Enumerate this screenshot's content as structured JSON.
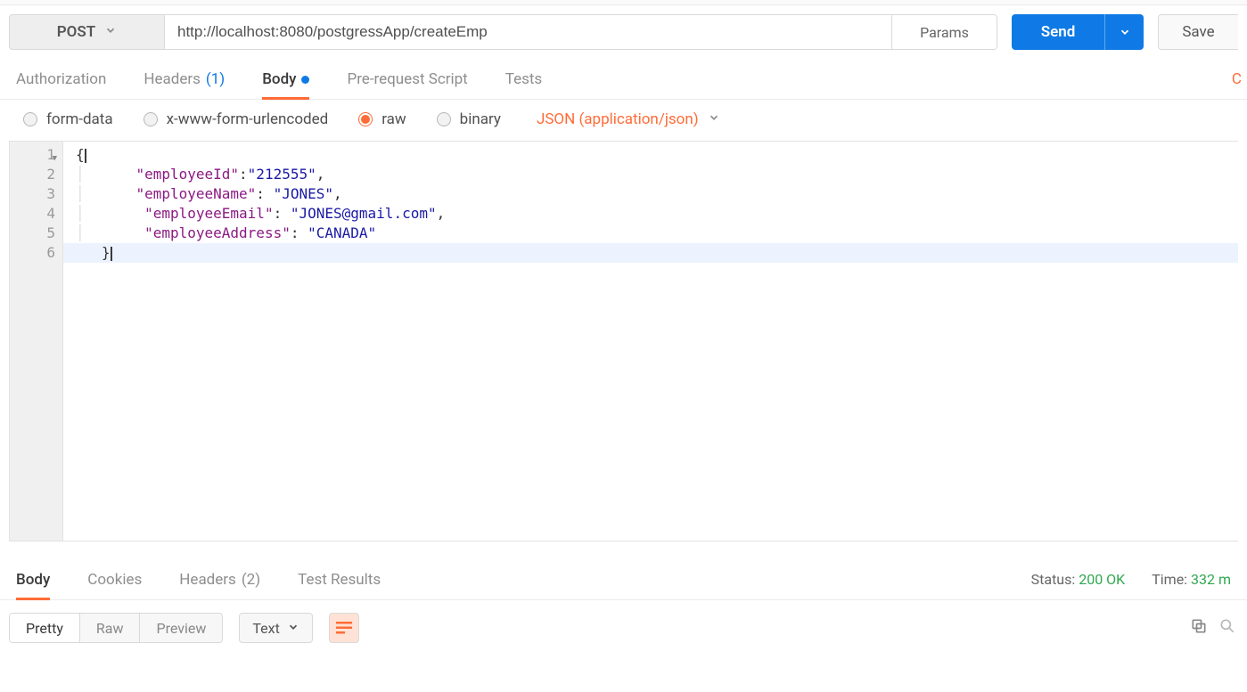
{
  "request": {
    "method": "POST",
    "url": "http://localhost:8080/postgressApp/createEmp",
    "params_label": "Params",
    "send_label": "Send",
    "save_label": "Save"
  },
  "request_tabs": {
    "authorization": "Authorization",
    "headers": "Headers",
    "headers_count": "(1)",
    "body": "Body",
    "prerequest": "Pre-request Script",
    "tests": "Tests",
    "overflow": "C"
  },
  "body_types": {
    "formdata": "form-data",
    "urlencoded": "x-www-form-urlencoded",
    "raw": "raw",
    "binary": "binary",
    "content_type": "JSON (application/json)",
    "selected": "raw"
  },
  "editor": {
    "line_numbers": [
      "1",
      "2",
      "3",
      "4",
      "5",
      "6"
    ],
    "json_payload": {
      "employeeId": "212555",
      "employeeName": "JONES",
      "employeeEmail": "JONES@gmail.com",
      "employeeAddress": "CANADA"
    },
    "lines": [
      {
        "indent": 0,
        "raw": "{"
      },
      {
        "indent": 1,
        "key": "employeeId",
        "sep": ":",
        "val": "212555",
        "trail": ","
      },
      {
        "indent": 1,
        "key": "employeeName",
        "sep": ": ",
        "val": "JONES",
        "trail": ","
      },
      {
        "indent": 1,
        "key": "employeeEmail",
        "sep": ": ",
        "val": "JONES@gmail.com",
        "trail": ","
      },
      {
        "indent": 1,
        "key": "employeeAddress",
        "sep": ": ",
        "val": "CANADA",
        "trail": ""
      },
      {
        "indent": 0,
        "raw": "}"
      }
    ],
    "highlight_line": 6
  },
  "response_tabs": {
    "body": "Body",
    "cookies": "Cookies",
    "headers": "Headers",
    "headers_count": "(2)",
    "test_results": "Test Results"
  },
  "response_status": {
    "status_label": "Status:",
    "status_value": "200 OK",
    "time_label": "Time:",
    "time_value": "332 m"
  },
  "response_view": {
    "pretty": "Pretty",
    "raw": "Raw",
    "preview": "Preview",
    "format": "Text"
  }
}
